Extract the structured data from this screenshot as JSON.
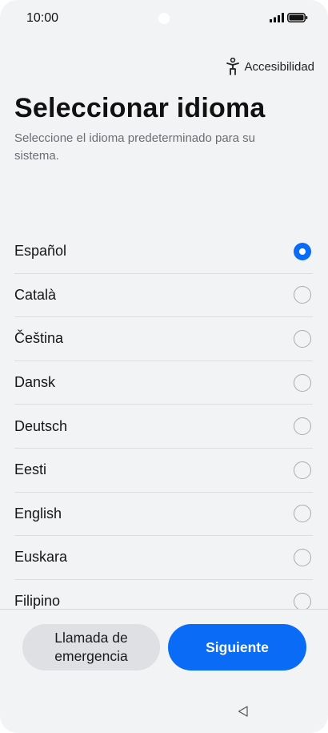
{
  "status_bar": {
    "time": "10:00",
    "icons": [
      "camera-cutout",
      "signal-icon",
      "battery-icon"
    ]
  },
  "accessibility": {
    "label": "Accesibilidad",
    "icon": "accessibility-icon"
  },
  "header": {
    "title": "Seleccionar idioma",
    "subtitle": "Seleccione el idioma predeterminado para su sistema."
  },
  "languages": {
    "items": [
      {
        "label": "Español",
        "selected": true
      },
      {
        "label": "Català",
        "selected": false
      },
      {
        "label": "Čeština",
        "selected": false
      },
      {
        "label": "Dansk",
        "selected": false
      },
      {
        "label": "Deutsch",
        "selected": false
      },
      {
        "label": "Eesti",
        "selected": false
      },
      {
        "label": "English",
        "selected": false
      },
      {
        "label": "Euskara",
        "selected": false
      },
      {
        "label": "Filipino",
        "selected": false
      }
    ]
  },
  "buttons": {
    "emergency_label": "Llamada de emergencia",
    "next_label": "Siguiente"
  },
  "nav": {
    "back_icon": "back-triangle-icon"
  },
  "colors": {
    "accent": "#0a6cf6",
    "background": "#f2f3f5",
    "secondary_button": "#dfe0e3"
  }
}
